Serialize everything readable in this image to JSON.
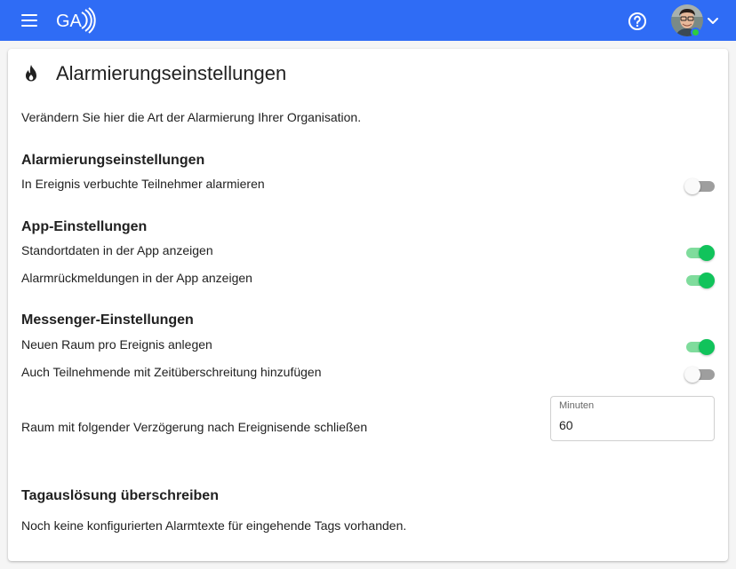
{
  "colors": {
    "topbar": "#2f6cf5",
    "toggle_on_knob": "#11c35b",
    "toggle_on_track": "#7fdc9c",
    "toggle_off_track": "#9e9e9e",
    "status_online": "#2ecc40"
  },
  "topbar": {
    "menu_icon": "hamburger-menu-icon",
    "logo_text": "GA",
    "help_icon": "help-circle-icon",
    "user_avatar": "user-avatar",
    "status": "online",
    "dropdown_icon": "chevron-down-icon"
  },
  "page": {
    "icon": "flame-icon",
    "title": "Alarmierungseinstellungen",
    "description": "Verändern Sie hier die Art der Alarmierung Ihrer Organisation."
  },
  "sections": {
    "alarm": {
      "title": "Alarmierungseinstellungen",
      "notify_booked": {
        "label": "In Ereignis verbuchte Teilnehmer alarmieren",
        "enabled": false
      }
    },
    "app": {
      "title": "App-Einstellungen",
      "show_location": {
        "label": "Standortdaten in der App anzeigen",
        "enabled": true
      },
      "show_feedback": {
        "label": "Alarmrückmeldungen in der App anzeigen",
        "enabled": true
      }
    },
    "messenger": {
      "title": "Messenger-Einstellungen",
      "new_room": {
        "label": "Neuen Raum pro Ereignis anlegen",
        "enabled": true
      },
      "add_overtime": {
        "label": "Auch Teilnehmende mit Zeitüberschreitung hinzufügen",
        "enabled": false
      },
      "close_room": {
        "label": "Raum mit folgender Verzögerung nach Ereignisende schließen",
        "field_label": "Minuten",
        "value": "60"
      }
    },
    "tags": {
      "title": "Tagauslösung überschreiben",
      "empty_text": "Noch keine konfigurierten Alarmtexte für eingehende Tags vorhanden."
    }
  }
}
